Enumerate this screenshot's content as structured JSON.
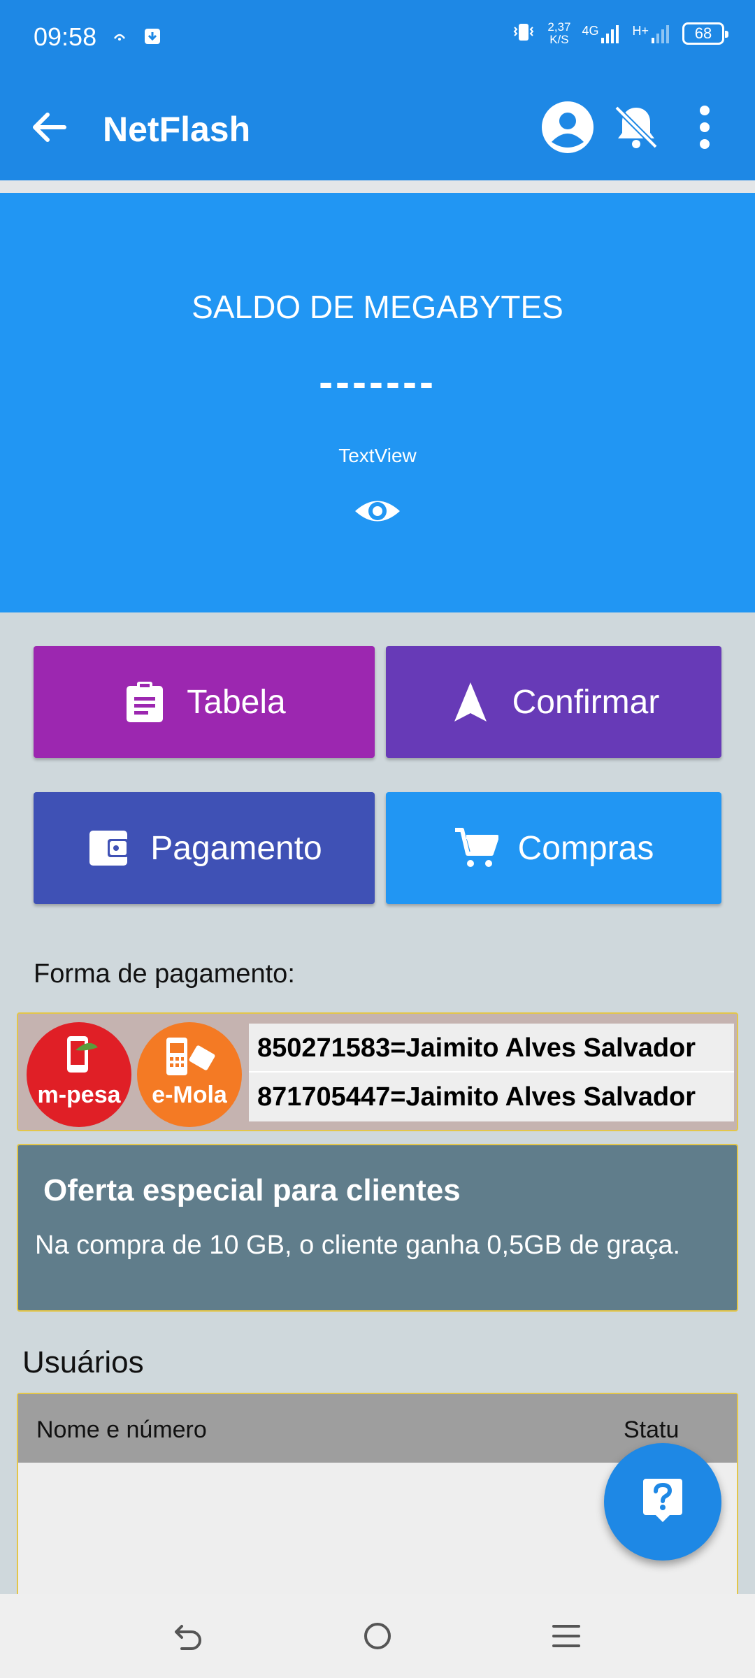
{
  "status_bar": {
    "time": "09:58",
    "speed_value": "2,37",
    "speed_unit": "K/S",
    "network_1": "4G",
    "network_2": "H+",
    "battery": "68"
  },
  "app_bar": {
    "title": "NetFlash",
    "icons": [
      "arrow-back-icon",
      "account-circle-icon",
      "notifications-off-icon",
      "more-vert-icon"
    ]
  },
  "balance": {
    "title": "SALDO DE MEGABYTES",
    "value": "-------",
    "text": "TextView",
    "icon": "eye-icon"
  },
  "actions": {
    "tabela": "Tabela",
    "confirmar": "Confirmar",
    "pagamento": "Pagamento",
    "compras": "Compras"
  },
  "payment": {
    "label": "Forma de pagamento:",
    "mpesa_logo": "m-pesa",
    "emola_logo": "e-Mola",
    "numbers": [
      "850271583=Jaimito Alves Salvador",
      "871705447=Jaimito Alves Salvador"
    ]
  },
  "offer": {
    "title": "Oferta especial para clientes",
    "text": "Na compra de 10 GB, o cliente ganha 0,5GB de graça."
  },
  "users": {
    "label": "Usuários",
    "columns": [
      "Nome e número",
      "Statu"
    ]
  },
  "colors": {
    "primary": "#1e88e5",
    "balance_bg": "#2196f3",
    "tabela": "#9c27b0",
    "confirmar": "#673ab7",
    "pagamento": "#3f51b5",
    "compras": "#2196f3",
    "offer_bg": "#607d8b"
  }
}
